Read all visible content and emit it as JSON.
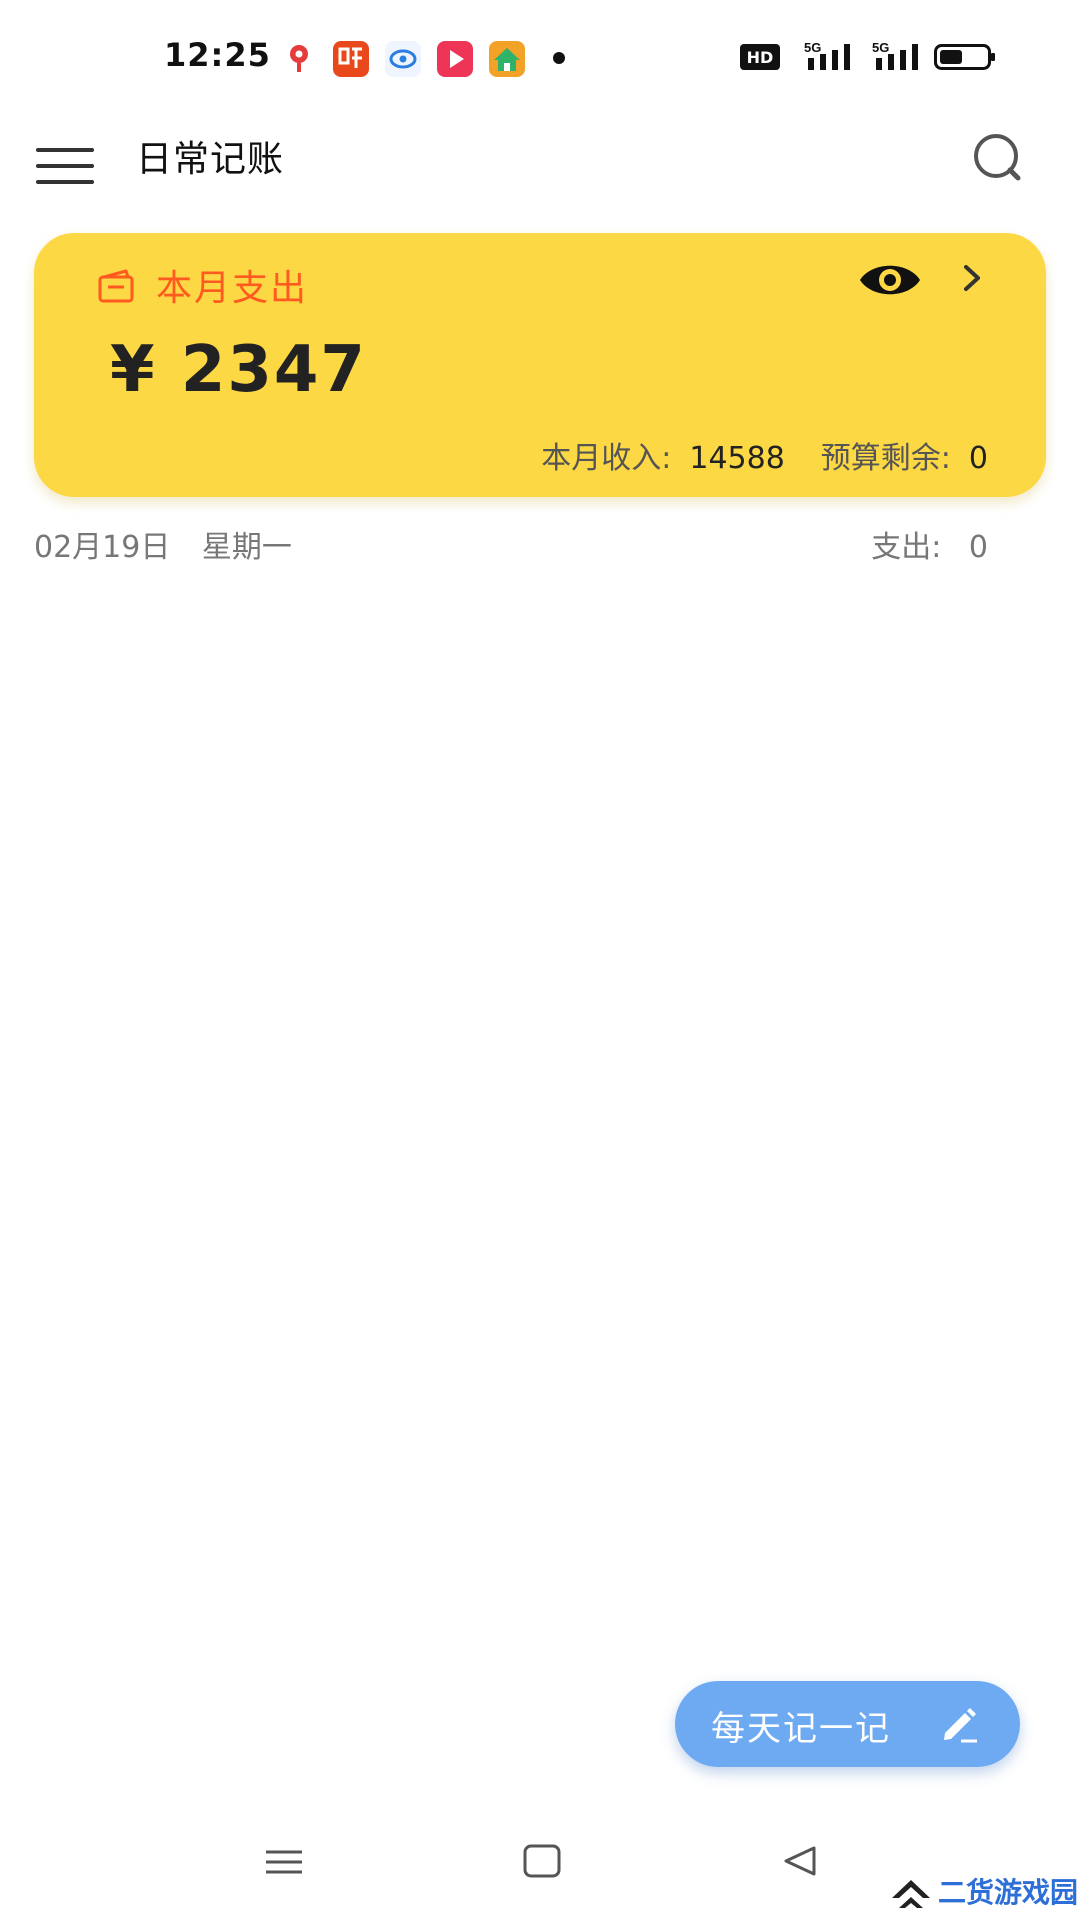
{
  "status_bar": {
    "time": "12:25",
    "hd_label": "HD",
    "signal_label": "5G",
    "icons": [
      "map-pin-app-icon",
      "listen-app-icon",
      "eye-app-icon",
      "video-app-icon",
      "home-app-icon"
    ]
  },
  "header": {
    "title": "日常记账",
    "menu_icon": "hamburger-menu-icon",
    "search_icon": "search-icon"
  },
  "summary": {
    "label": "本月支出",
    "amount": "¥ 2347",
    "income_label": "本月收入:",
    "income_value": "14588",
    "budget_label": "预算剩余:",
    "budget_value": "0",
    "colors": {
      "card_bg": "#fcd844",
      "label": "#ff5a1f"
    }
  },
  "day": {
    "date": "02月19日",
    "weekday": "星期一",
    "expense_label": "支出:",
    "expense_value": "0"
  },
  "fab": {
    "label": "每天记一记",
    "color": "#6eaaf2"
  },
  "watermark": {
    "text": "二货游戏园"
  }
}
